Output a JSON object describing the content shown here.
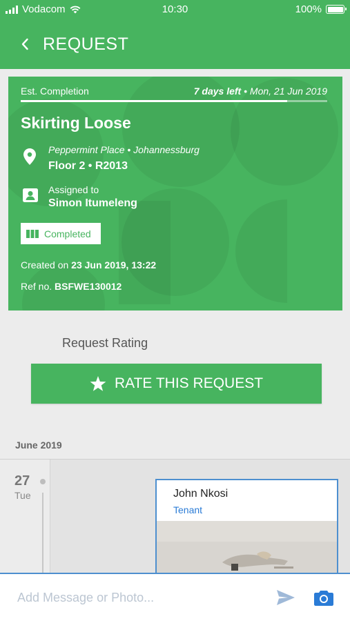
{
  "status_bar": {
    "carrier": "Vodacom",
    "time": "10:30",
    "battery": "100%"
  },
  "header": {
    "title": "REQUEST"
  },
  "request": {
    "est_label": "Est. Completion",
    "days_left": "7 days left",
    "separator": " • ",
    "due_date": "Mon, 21 Jun 2019",
    "progress": 0.87,
    "title": "Skirting Loose",
    "location_line1": "Peppermint Place • Johannessburg",
    "location_line2": "Floor 2 • R2013",
    "assigned_label": "Assigned to",
    "assigned_name": "Simon Itumeleng",
    "status": "Completed",
    "created_prefix": "Created on ",
    "created_value": "23 Jun 2019, 13:22",
    "ref_prefix": "Ref no. ",
    "ref_value": "BSFWE130012"
  },
  "rating": {
    "label": "Request Rating",
    "button": "RATE THIS REQUEST"
  },
  "timeline": {
    "month": "June 2019",
    "day_number": "27",
    "day_name": "Tue",
    "message": {
      "author": "John Nkosi",
      "role": "Tenant"
    }
  },
  "composer": {
    "placeholder": "Add Message or Photo..."
  },
  "colors": {
    "brand": "#47b45f",
    "accent_blue": "#2a7bd6"
  }
}
